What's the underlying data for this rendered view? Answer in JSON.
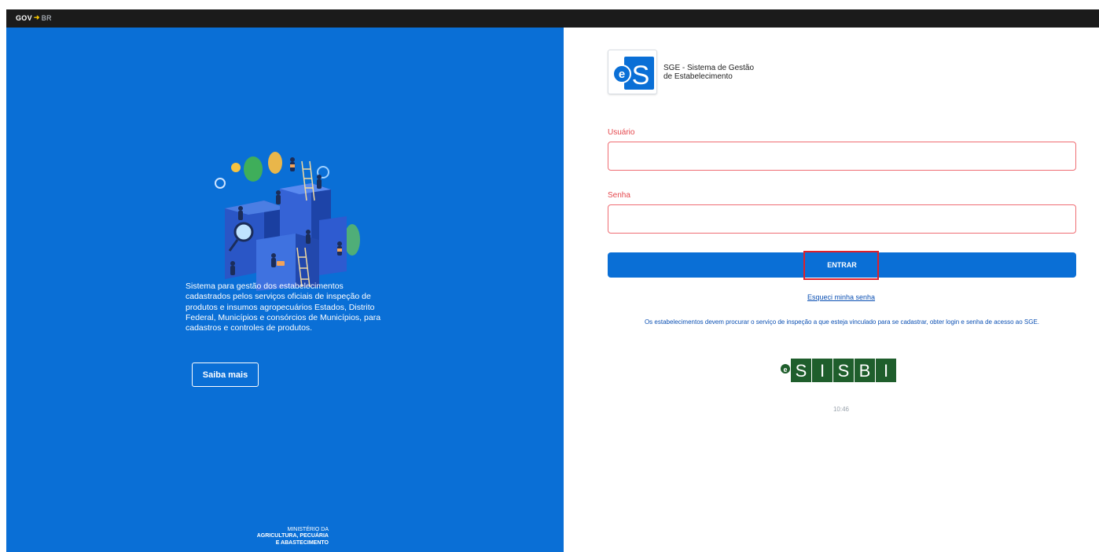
{
  "topbar": {
    "gov_logo_text": "GOV",
    "gov_logo_suffix": "BR"
  },
  "left": {
    "description": "Sistema para gestão dos estabelecimentos cadastrados pelos serviços oficiais de inspeção de produtos e insumos agropecuários Estados, Distrito Federal, Municípios e consórcios de Municípios, para cadastros e controles de produtos.",
    "saiba_mais_label": "Saiba mais",
    "ministry": {
      "line1": "MINISTÉRIO DA",
      "line2": "AGRICULTURA, PECUÁRIA",
      "line3": "E ABASTECIMENTO"
    }
  },
  "brand": {
    "logo_letters": "eS",
    "title_line1": "SGE - Sistema de Gestão",
    "title_line2": "de Estabelecimento"
  },
  "form": {
    "usuario_label": "Usuário",
    "usuario_value": "",
    "senha_label": "Senha",
    "senha_value": "",
    "entrar_label": "ENTRAR",
    "forgot_label": "Esqueci minha senha",
    "info_text": "Os estabelecimentos devem procurar o serviço de inspeção a que esteja vinculado para se cadastrar, obter login e senha de acesso ao SGE."
  },
  "sisbi": {
    "prefix": "e",
    "letters": [
      "S",
      "I",
      "S",
      "B",
      "I"
    ]
  },
  "clock": "10:46",
  "colors": {
    "brand_blue": "#0a6fd6",
    "topbar_dark": "#1b1b1b",
    "error_red": "#e5484d",
    "highlight_red": "#e0202a",
    "sisbi_green": "#1f5e2c"
  }
}
